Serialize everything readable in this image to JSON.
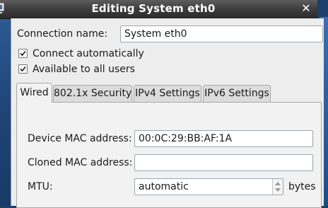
{
  "window": {
    "title": "Editing System eth0"
  },
  "icons": {
    "title": "network-window-icon",
    "close": "close-icon"
  },
  "close_glyph": "✕",
  "connection": {
    "label": "Connection name:",
    "value": "System eth0"
  },
  "options": {
    "connect_automatically": {
      "label": "Connect automatically",
      "checked": true
    },
    "available_to_all_users": {
      "label": "Available to all users",
      "checked": true
    }
  },
  "tabs": [
    {
      "label": "Wired",
      "active": true
    },
    {
      "label": "802.1x Security",
      "active": false
    },
    {
      "label": "IPv4 Settings",
      "active": false
    },
    {
      "label": "IPv6 Settings",
      "active": false
    }
  ],
  "wired": {
    "device_mac": {
      "label": "Device MAC address:",
      "value": "00:0C:29:BB:AF:1A"
    },
    "cloned_mac": {
      "label": "Cloned MAC address:",
      "value": ""
    },
    "mtu": {
      "label": "MTU:",
      "value": "automatic",
      "unit": "bytes"
    }
  }
}
